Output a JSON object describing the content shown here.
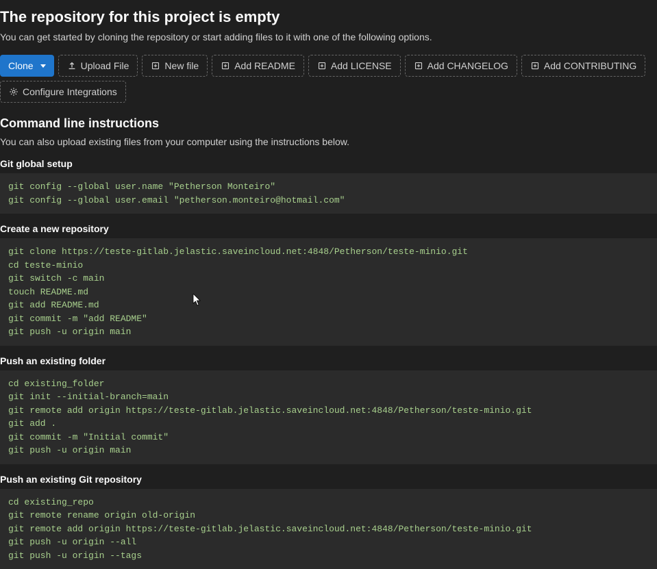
{
  "header": {
    "title": "The repository for this project is empty",
    "subtitle": "You can get started by cloning the repository or start adding files to it with one of the following options."
  },
  "actions": {
    "clone": "Clone",
    "upload": "Upload File",
    "newfile": "New file",
    "readme": "Add README",
    "license": "Add LICENSE",
    "changelog": "Add CHANGELOG",
    "contributing": "Add CONTRIBUTING",
    "configure": "Configure Integrations"
  },
  "cli": {
    "title": "Command line instructions",
    "desc": "You can also upload existing files from your computer using the instructions below."
  },
  "sections": {
    "global": {
      "heading": "Git global setup",
      "code": "git config --global user.name \"Petherson Monteiro\"\ngit config --global user.email \"petherson.monteiro@hotmail.com\""
    },
    "create": {
      "heading": "Create a new repository",
      "code": "git clone https://teste-gitlab.jelastic.saveincloud.net:4848/Petherson/teste-minio.git\ncd teste-minio\ngit switch -c main\ntouch README.md\ngit add README.md\ngit commit -m \"add README\"\ngit push -u origin main"
    },
    "folder": {
      "heading": "Push an existing folder",
      "code": "cd existing_folder\ngit init --initial-branch=main\ngit remote add origin https://teste-gitlab.jelastic.saveincloud.net:4848/Petherson/teste-minio.git\ngit add .\ngit commit -m \"Initial commit\"\ngit push -u origin main"
    },
    "repo": {
      "heading": "Push an existing Git repository",
      "code": "cd existing_repo\ngit remote rename origin old-origin\ngit remote add origin https://teste-gitlab.jelastic.saveincloud.net:4848/Petherson/teste-minio.git\ngit push -u origin --all\ngit push -u origin --tags"
    }
  }
}
